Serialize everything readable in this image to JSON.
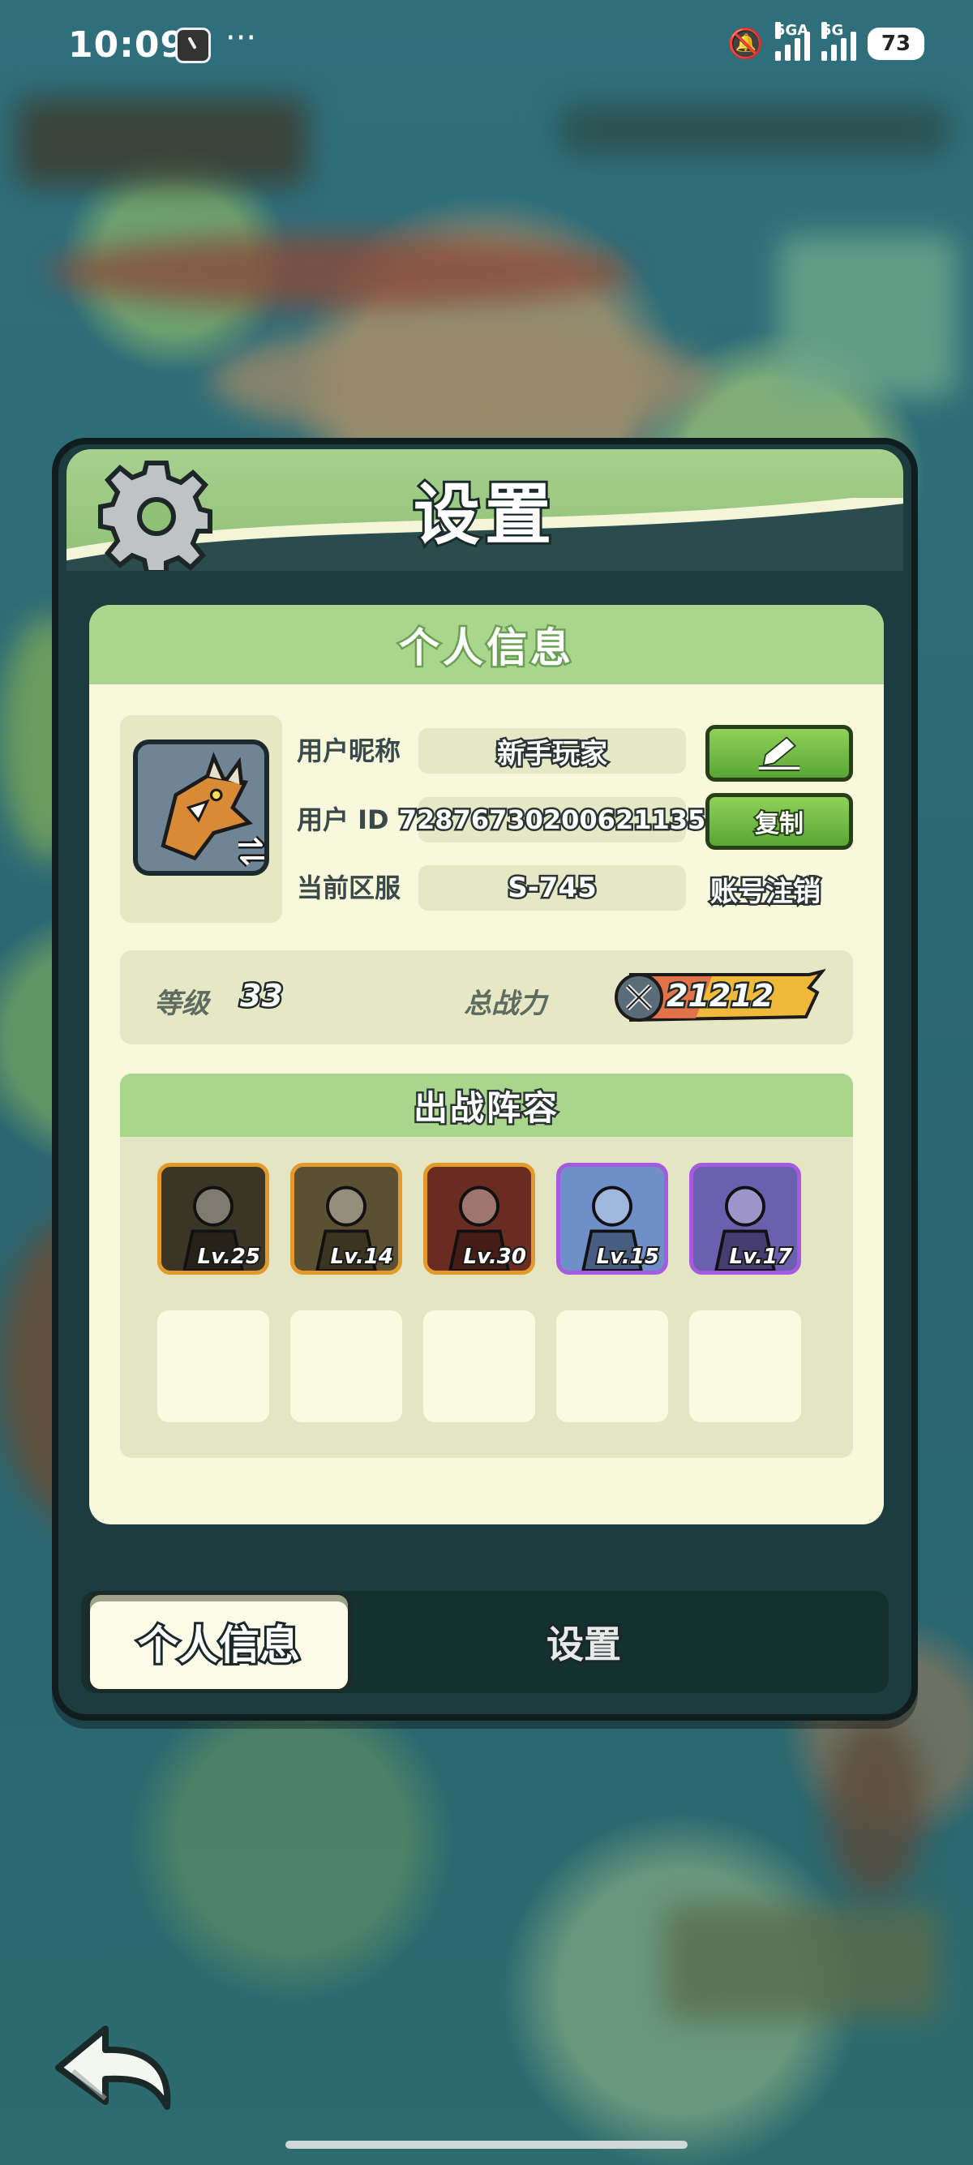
{
  "status_bar": {
    "time": "10:09",
    "dots": "···",
    "signal1_label": "5GA",
    "signal2_label": "5G",
    "battery": "73"
  },
  "dialog": {
    "title": "设置",
    "panel_title": "个人信息",
    "nickname_label": "用户昵称",
    "nickname_value": "新手玩家",
    "userid_label": "用户  ID",
    "userid_value": "72876730200621135",
    "copy_button": "复制",
    "server_label": "当前区服",
    "server_value": "S-745",
    "cancel_account_link": "账号注销",
    "level_label": "等级",
    "level_value": "33",
    "power_label": "总战力",
    "power_value": "21212",
    "lineup_title": "出战阵容",
    "heroes": [
      {
        "level": "Lv.25",
        "frame": "gold",
        "color": "#3b3526"
      },
      {
        "level": "Lv.14",
        "frame": "gold",
        "color": "#5b5132"
      },
      {
        "level": "Lv.30",
        "frame": "gold",
        "color": "#6a2b22"
      },
      {
        "level": "Lv.15",
        "frame": "purple",
        "color": "#6f8fc8"
      },
      {
        "level": "Lv.17",
        "frame": "purple",
        "color": "#6b5fb0"
      }
    ]
  },
  "tabs": {
    "active": "个人信息",
    "inactive": "设置"
  },
  "colors": {
    "accent_green": "#8fc075",
    "panel_bg": "#f7f8dc",
    "dialog_bg": "#1c3c40"
  }
}
